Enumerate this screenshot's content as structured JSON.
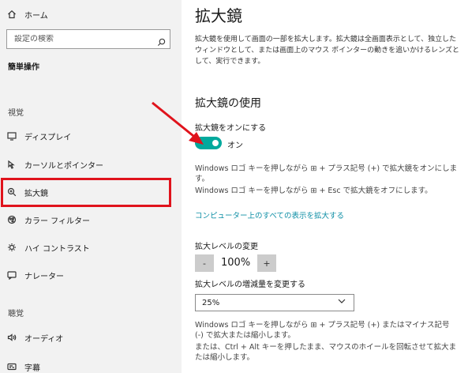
{
  "sidebar": {
    "home_label": "ホーム",
    "search_placeholder": "設定の検索",
    "section_title": "簡単操作",
    "category_vision": "視覚",
    "category_hearing": "聴覚",
    "items": [
      {
        "label": "ディスプレイ",
        "icon": "display-icon"
      },
      {
        "label": "カーソルとポインター",
        "icon": "cursor-icon"
      },
      {
        "label": "拡大鏡",
        "icon": "magnifier-icon"
      },
      {
        "label": "カラー フィルター",
        "icon": "color-filter-icon"
      },
      {
        "label": "ハイ コントラスト",
        "icon": "high-contrast-icon"
      },
      {
        "label": "ナレーター",
        "icon": "narrator-icon"
      },
      {
        "label": "オーディオ",
        "icon": "audio-icon"
      },
      {
        "label": "字幕",
        "icon": "captions-icon"
      }
    ]
  },
  "main": {
    "title": "拡大鏡",
    "description": "拡大鏡を使用して画面の一部を拡大します。拡大鏡は全画面表示として、独立したウィンドウとして、または画面上のマウス ポインターの動きを追いかけるレンズとして、実行できます。",
    "use_heading": "拡大鏡の使用",
    "toggle_label": "拡大鏡をオンにする",
    "toggle_state": "オン",
    "toggle_on": true,
    "shortcut_note_1": "Windows ロゴ キーを押しながら ⊞ + プラス記号 (+) で拡大鏡をオンにします。",
    "shortcut_note_2": "Windows ロゴ キーを押しながら ⊞ + Esc で拡大鏡をオフにします。",
    "link": "コンピューター上のすべての表示を拡大する",
    "zoom_label": "拡大レベルの変更",
    "zoom_minus": "-",
    "zoom_value": "100%",
    "zoom_plus": "+",
    "increment_label": "拡大レベルの増減量を変更する",
    "increment_value": "25%",
    "zoom_note_1": "Windows ロゴ キーを押しながら ⊞ + プラス記号 (+) またはマイナス記号 (-) で拡大または縮小します。",
    "zoom_note_2": "または、Ctrl + Alt キーを押したまま、マウスのホイールを回転させて拡大または縮小します。"
  },
  "colors": {
    "accent": "#00a99d",
    "link": "#0f8fa6",
    "highlight": "#e0131c",
    "sidebar_bg": "#f2f2f2"
  }
}
